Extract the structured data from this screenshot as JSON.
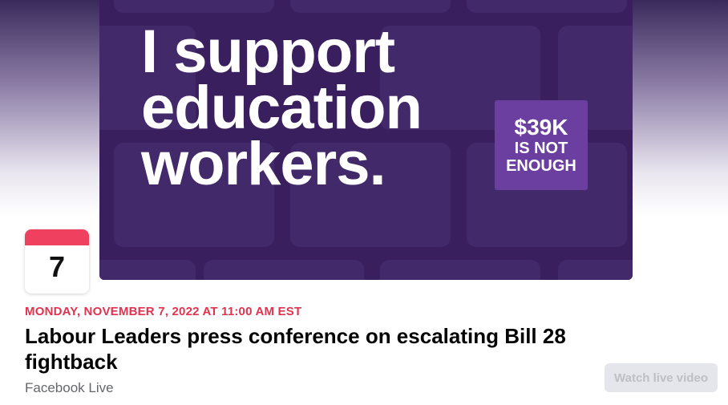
{
  "cover": {
    "headline_lines": [
      "I support",
      "education",
      "workers."
    ],
    "badge": {
      "amount": "$39K",
      "line1": "IS NOT",
      "line2": "ENOUGH"
    }
  },
  "calendar": {
    "day": "7"
  },
  "event": {
    "date": "MONDAY, NOVEMBER 7, 2022 AT 11:00 AM EST",
    "title": "Labour Leaders press conference on escalating Bill 28 fightback",
    "host": "Facebook Live"
  },
  "actions": {
    "watch_label": "Watch live video"
  },
  "colors": {
    "cover_bg": "#3a1f5f",
    "badge_bg": "#6b3fa0",
    "date_red": "#e0334f",
    "calendar_strip": "#f0405f"
  }
}
